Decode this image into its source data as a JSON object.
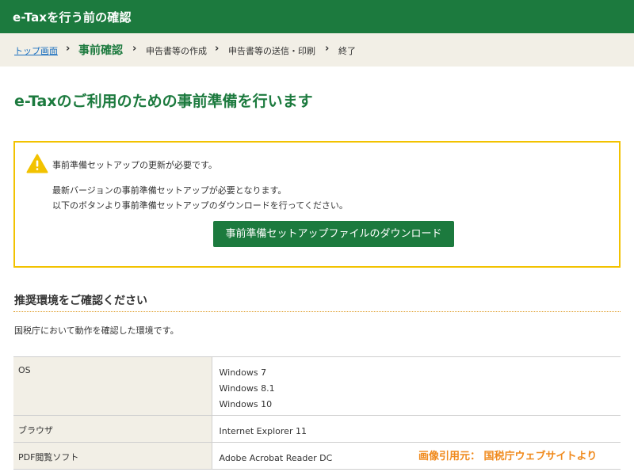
{
  "header": {
    "title": "e-Taxを行う前の確認"
  },
  "breadcrumb": {
    "items": [
      {
        "label": "トップ画面"
      },
      {
        "label": "事前確認"
      },
      {
        "label": "申告書等の作成"
      },
      {
        "label": "申告書等の送信・印刷"
      },
      {
        "label": "終了"
      }
    ],
    "separator": "›"
  },
  "main": {
    "title": "e-Taxのご利用のための事前準備を行います",
    "alert": {
      "icon": "warning-icon",
      "accent_color": "#f2c200",
      "message": "事前準備セットアップの更新が必要です。",
      "detail_line1": "最新バージョンの事前準備セットアップが必要となります。",
      "detail_line2": "以下のボタンより事前準備セットアップのダウンロードを行ってください。",
      "button_label": "事前準備セットアップファイルのダウンロード"
    },
    "environment": {
      "heading": "推奨環境をご確認ください",
      "description": "国税庁において動作を確認した環境です。",
      "rows": [
        {
          "label": "OS",
          "values": [
            "Windows 7",
            "Windows 8.1",
            "Windows 10"
          ]
        },
        {
          "label": "ブラウザ",
          "values": [
            "Internet Explorer 11"
          ]
        },
        {
          "label": "PDF閲覧ソフト",
          "values": [
            "Adobe Acrobat Reader DC"
          ]
        }
      ]
    }
  },
  "credit": "画像引用元： 国税庁ウェブサイトより",
  "colors": {
    "brand_green": "#1c7a3e",
    "breadcrumb_bg": "#f2efe6",
    "warning_yellow": "#f2c200",
    "credit_orange": "#f08a1d",
    "link_blue": "#1a6fbf"
  }
}
